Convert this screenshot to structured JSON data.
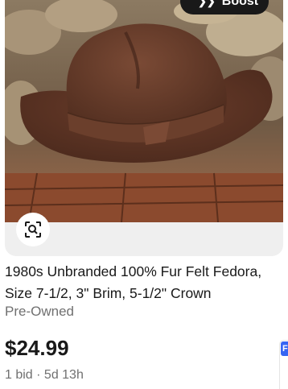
{
  "listing": {
    "boost_label": "Boost",
    "title": "1980s Unbranded 100% Fur Felt Fedora, Size 7-1/2, 3\" Brim, 5-1/2\" Crown",
    "condition": "Pre-Owned",
    "price": "$24.99",
    "meta": "1 bid · 5d 13h",
    "image_alt": "Brown felt fedora hat on rocks",
    "icons": [
      "boost-icon",
      "visual-search-icon"
    ]
  },
  "next_card": {
    "badge": "F"
  },
  "colors": {
    "text": "#191919",
    "muted": "#707070",
    "accent": "#3665f3",
    "image_bg": "#efefef"
  }
}
